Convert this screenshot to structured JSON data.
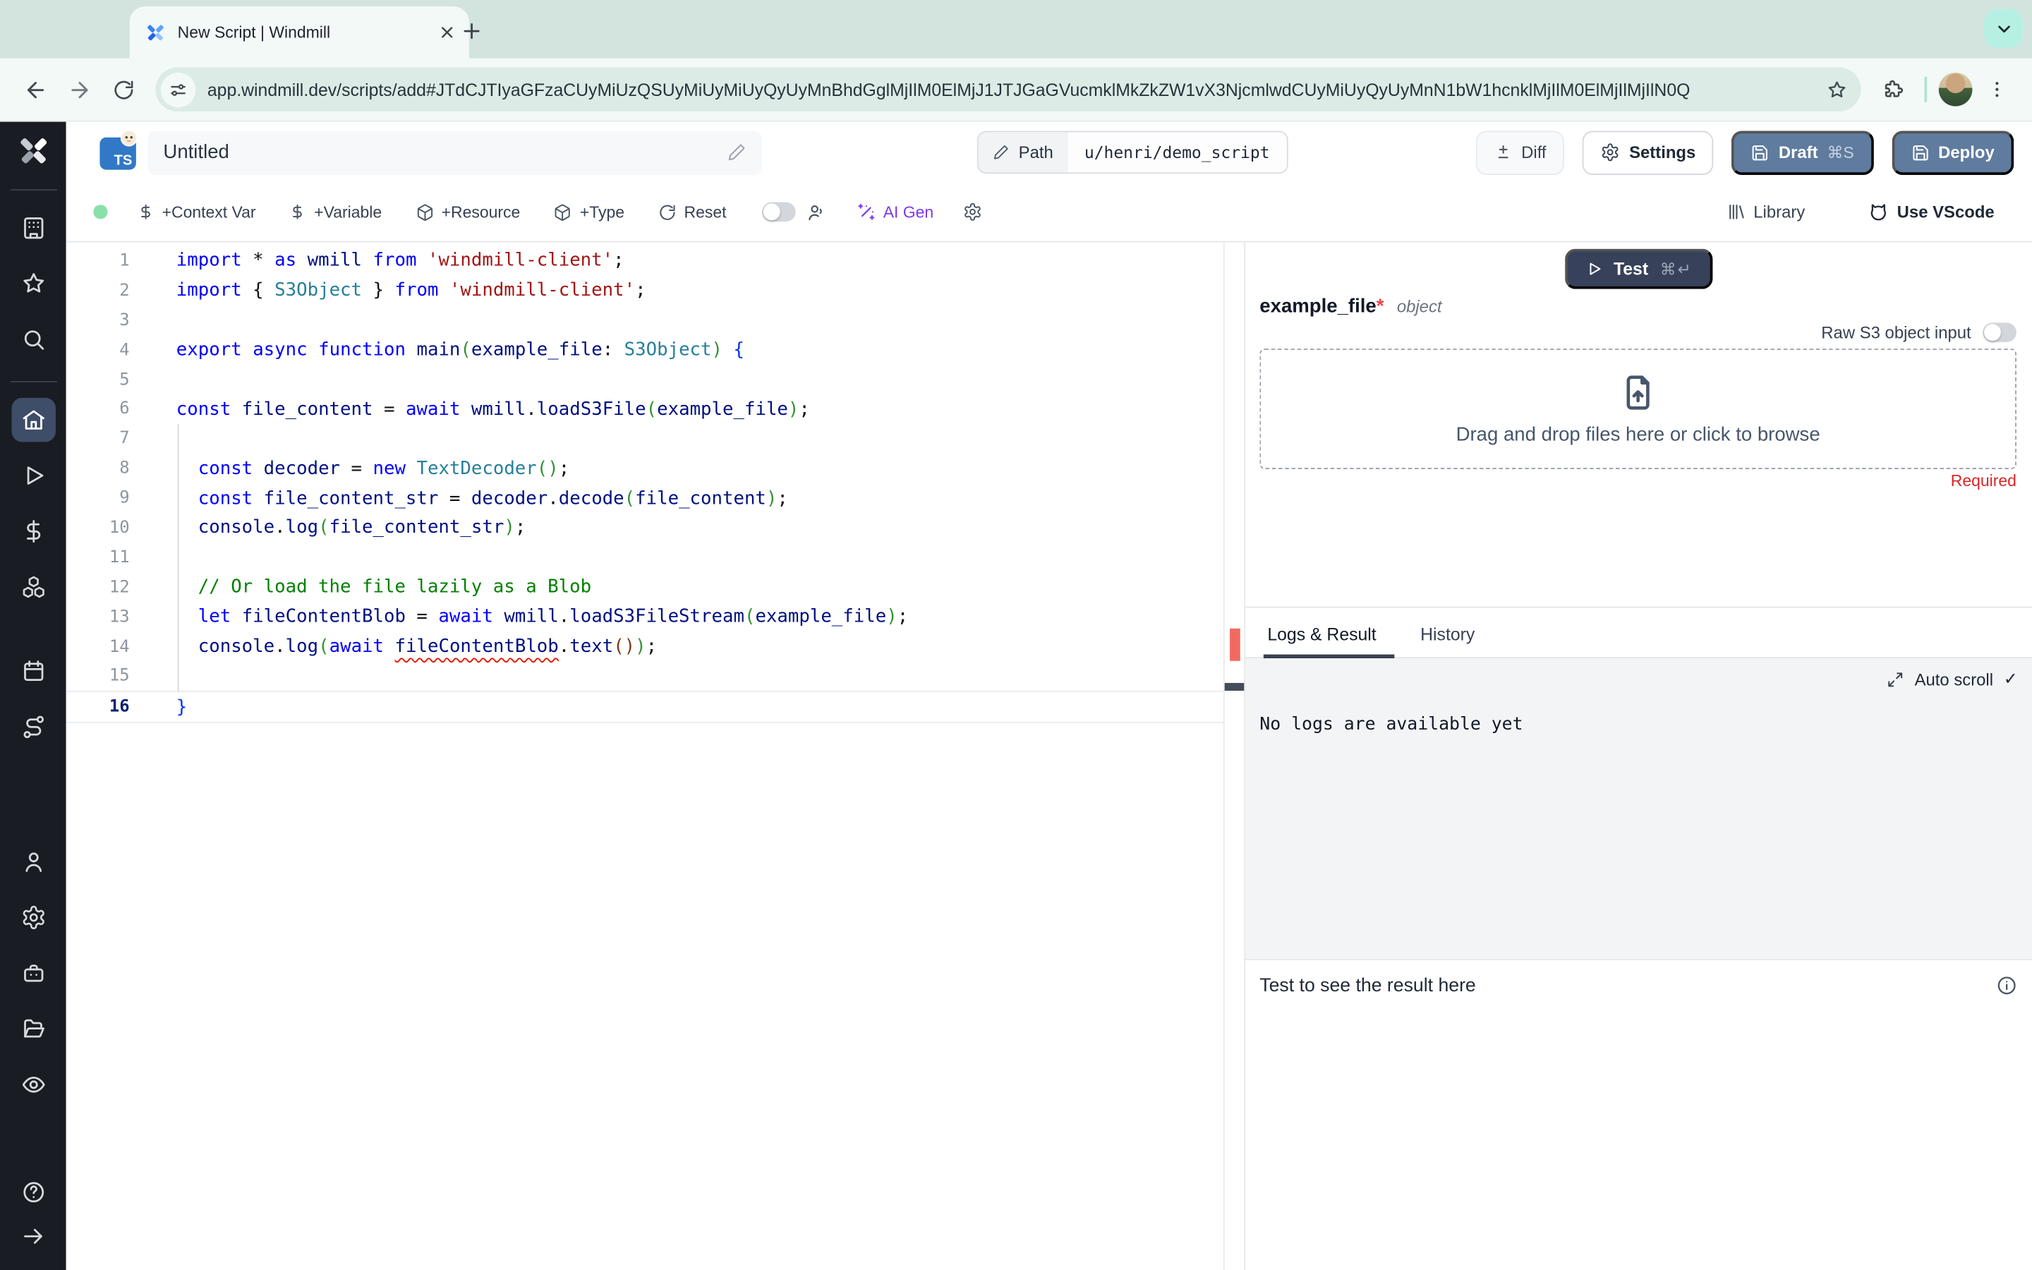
{
  "browser": {
    "tab_title": "New Script | Windmill",
    "url": "app.windmill.dev/scripts/add#JTdCJTIyaGFzaCUyMiUzQSUyMiUyMiUyQyUyMnBhdGglMjIlM0ElMjJ1JTJGaGVucmklMkZkZW1vX3NjcmlwdCUyMiUyQyUyMnN1bW1hcnklMjIlM0ElMjIlMjIlN0Q"
  },
  "header": {
    "language_badge": "TS",
    "title": "Untitled",
    "path_label": "Path",
    "path_value": "u/henri/demo_script",
    "diff_label": "Diff",
    "settings_label": "Settings",
    "draft_label": "Draft",
    "draft_shortcut": "⌘S",
    "deploy_label": "Deploy"
  },
  "toolbar": {
    "context_var": "+Context Var",
    "variable": "+Variable",
    "resource": "+Resource",
    "type": "+Type",
    "reset": "Reset",
    "ai_gen": "AI Gen",
    "library": "Library",
    "vscode": "Use VScode"
  },
  "editor": {
    "lines": [
      {
        "n": 1,
        "tokens": [
          [
            "k",
            "import"
          ],
          [
            "p",
            " * "
          ],
          [
            "k",
            "as"
          ],
          [
            "v",
            " wmill"
          ],
          [
            "p",
            " "
          ],
          [
            "k",
            "from"
          ],
          [
            "s",
            " 'windmill-client'"
          ],
          [
            "p",
            ";"
          ]
        ]
      },
      {
        "n": 2,
        "tokens": [
          [
            "k",
            "import"
          ],
          [
            "p",
            " { "
          ],
          [
            "t",
            "S3Object"
          ],
          [
            "p",
            " } "
          ],
          [
            "k",
            "from"
          ],
          [
            "s",
            " 'windmill-client'"
          ],
          [
            "p",
            ";"
          ]
        ]
      },
      {
        "n": 3,
        "tokens": []
      },
      {
        "n": 4,
        "tokens": [
          [
            "k",
            "export"
          ],
          [
            "p",
            " "
          ],
          [
            "k",
            "async"
          ],
          [
            "p",
            " "
          ],
          [
            "k",
            "function"
          ],
          [
            "p",
            " "
          ],
          [
            "v",
            "main"
          ],
          [
            "b1",
            "("
          ],
          [
            "v",
            "example_file"
          ],
          [
            "p",
            ": "
          ],
          [
            "t",
            "S3Object"
          ],
          [
            "b1",
            ")"
          ],
          [
            "p",
            " "
          ],
          [
            "bb",
            "{"
          ]
        ]
      },
      {
        "n": 5,
        "tokens": []
      },
      {
        "n": 6,
        "tokens": [
          [
            "k",
            "const"
          ],
          [
            "v",
            " file_content"
          ],
          [
            "p",
            " = "
          ],
          [
            "k",
            "await"
          ],
          [
            "p",
            " "
          ],
          [
            "v",
            "wmill"
          ],
          [
            "p",
            "."
          ],
          [
            "v",
            "loadS3File"
          ],
          [
            "b1",
            "("
          ],
          [
            "v",
            "example_file"
          ],
          [
            "b1",
            ")"
          ],
          [
            "p",
            ";"
          ]
        ]
      },
      {
        "n": 7,
        "tokens": []
      },
      {
        "n": 8,
        "tokens": [
          [
            "p",
            "  "
          ],
          [
            "k",
            "const"
          ],
          [
            "v",
            " decoder"
          ],
          [
            "p",
            " = "
          ],
          [
            "k",
            "new"
          ],
          [
            "p",
            " "
          ],
          [
            "t",
            "TextDecoder"
          ],
          [
            "b1",
            "()"
          ],
          [
            "p",
            ";"
          ]
        ]
      },
      {
        "n": 9,
        "tokens": [
          [
            "p",
            "  "
          ],
          [
            "k",
            "const"
          ],
          [
            "v",
            " file_content_str"
          ],
          [
            "p",
            " = "
          ],
          [
            "v",
            "decoder"
          ],
          [
            "p",
            "."
          ],
          [
            "v",
            "decode"
          ],
          [
            "b1",
            "("
          ],
          [
            "v",
            "file_content"
          ],
          [
            "b1",
            ")"
          ],
          [
            "p",
            ";"
          ]
        ]
      },
      {
        "n": 10,
        "tokens": [
          [
            "p",
            "  "
          ],
          [
            "v",
            "console"
          ],
          [
            "p",
            "."
          ],
          [
            "v",
            "log"
          ],
          [
            "b1",
            "("
          ],
          [
            "v",
            "file_content_str"
          ],
          [
            "b1",
            ")"
          ],
          [
            "p",
            ";"
          ]
        ]
      },
      {
        "n": 11,
        "tokens": []
      },
      {
        "n": 12,
        "tokens": [
          [
            "c",
            "  // Or load the file lazily as a Blob"
          ]
        ]
      },
      {
        "n": 13,
        "tokens": [
          [
            "p",
            "  "
          ],
          [
            "k",
            "let"
          ],
          [
            "v",
            " fileContentBlob"
          ],
          [
            "p",
            " = "
          ],
          [
            "k",
            "await"
          ],
          [
            "p",
            " "
          ],
          [
            "v",
            "wmill"
          ],
          [
            "p",
            "."
          ],
          [
            "v",
            "loadS3FileStream"
          ],
          [
            "b1",
            "("
          ],
          [
            "v",
            "example_file"
          ],
          [
            "b1",
            ")"
          ],
          [
            "p",
            ";"
          ]
        ]
      },
      {
        "n": 14,
        "tokens": [
          [
            "p",
            "  "
          ],
          [
            "v",
            "console"
          ],
          [
            "p",
            "."
          ],
          [
            "v",
            "log"
          ],
          [
            "b1",
            "("
          ],
          [
            "k",
            "await"
          ],
          [
            "p",
            " "
          ],
          [
            "err",
            "fileContentBlob"
          ],
          [
            "p",
            "."
          ],
          [
            "v",
            "text"
          ],
          [
            "b3",
            "()"
          ],
          [
            "b1",
            ")"
          ],
          [
            "p",
            ";"
          ]
        ]
      },
      {
        "n": 15,
        "tokens": []
      },
      {
        "n": 16,
        "active": true,
        "tokens": [
          [
            "bb",
            "}"
          ]
        ]
      }
    ]
  },
  "preview": {
    "test_label": "Test",
    "test_shortcut": "⌘↵",
    "arg_name": "example_file",
    "arg_required_mark": "*",
    "arg_type": "object",
    "raw_s3_label": "Raw S3 object input",
    "dropzone_text": "Drag and drop files here or click to browse",
    "required_label": "Required",
    "tabs": [
      "Logs & Result",
      "History"
    ],
    "auto_scroll_label": "Auto scroll",
    "check_mark": "✓",
    "no_logs_text": "No logs are available yet",
    "result_placeholder": "Test to see the result here"
  },
  "colors": {
    "brand_blue": "#3178c6",
    "button_slate": "#5f7b9e",
    "test_button": "#37425a",
    "ai_purple": "#7c3aed",
    "error_red": "#dc2626",
    "status_green": "#8ae0a9"
  }
}
